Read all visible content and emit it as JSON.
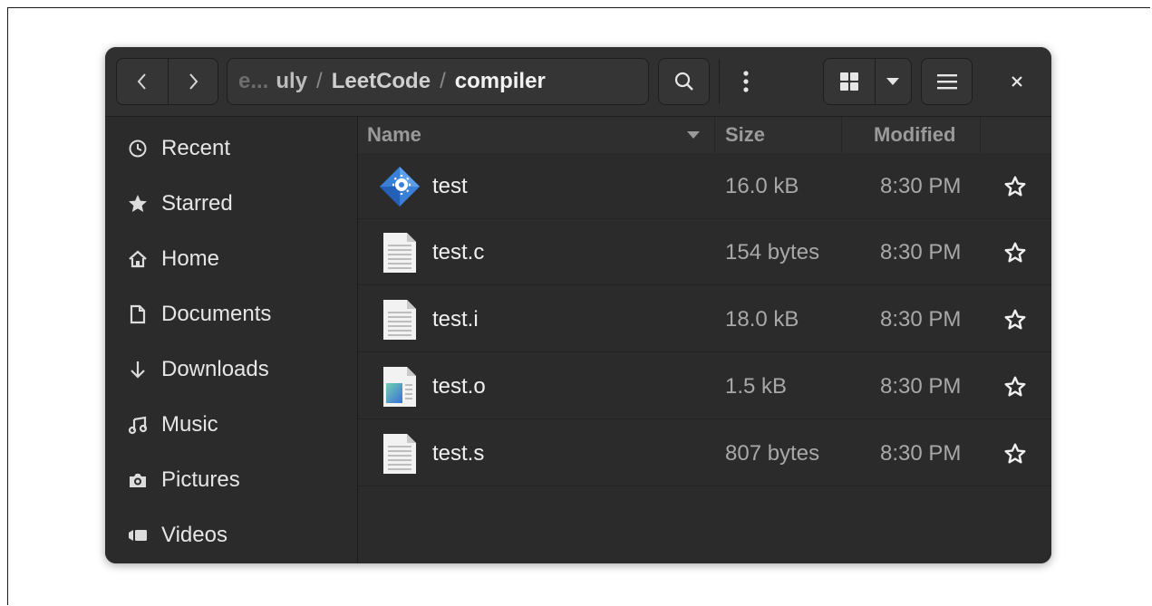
{
  "colors": {
    "window_bg": "#2b2b2b",
    "headerbar_bg": "#303030",
    "text_primary": "#f0f0f0",
    "text_secondary": "#a8a8a8",
    "accent_blue": "#3584e4"
  },
  "header": {
    "back_icon": "chevron-left-icon",
    "forward_icon": "chevron-right-icon",
    "path": {
      "faded_prefix": "e...",
      "segment_1": "uly",
      "separator": "/",
      "segment_2": "LeetCode",
      "current": "compiler"
    },
    "path_menu_icon": "vertical-dots-icon",
    "search_icon": "search-icon",
    "view_grid_icon": "grid-view-icon",
    "view_dropdown_icon": "caret-down-icon",
    "menu_icon": "hamburger-icon",
    "close_icon": "close-icon"
  },
  "sidebar": {
    "items": [
      {
        "label": "Recent",
        "icon": "clock-icon"
      },
      {
        "label": "Starred",
        "icon": "star-icon"
      },
      {
        "label": "Home",
        "icon": "home-icon"
      },
      {
        "label": "Documents",
        "icon": "document-icon"
      },
      {
        "label": "Downloads",
        "icon": "download-arrow-icon"
      },
      {
        "label": "Music",
        "icon": "music-note-icon"
      },
      {
        "label": "Pictures",
        "icon": "camera-icon"
      },
      {
        "label": "Videos",
        "icon": "video-icon"
      }
    ]
  },
  "columns": {
    "name": "Name",
    "size": "Size",
    "modified": "Modified"
  },
  "files": [
    {
      "name": "test",
      "size": "16.0 kB",
      "modified": "8:30 PM",
      "icon": "executable-icon"
    },
    {
      "name": "test.c",
      "size": "154 bytes",
      "modified": "8:30 PM",
      "icon": "text-file-icon"
    },
    {
      "name": "test.i",
      "size": "18.0 kB",
      "modified": "8:30 PM",
      "icon": "text-file-icon"
    },
    {
      "name": "test.o",
      "size": "1.5 kB",
      "modified": "8:30 PM",
      "icon": "object-file-icon"
    },
    {
      "name": "test.s",
      "size": "807 bytes",
      "modified": "8:30 PM",
      "icon": "text-file-icon"
    }
  ]
}
